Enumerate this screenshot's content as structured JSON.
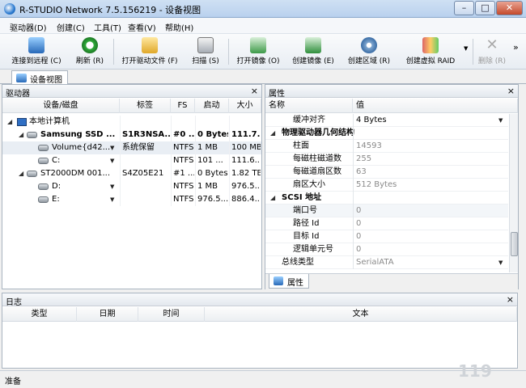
{
  "window": {
    "title": "R-STUDIO Network 7.5.156219 - 设备视图"
  },
  "menu": [
    "驱动器(D)",
    "创建(C)",
    "工具(T)",
    "查看(V)",
    "帮助(H)"
  ],
  "toolbar": [
    {
      "label": "连接到远程 (C)",
      "icon": "connect-remote-icon"
    },
    {
      "label": "刷新 (R)",
      "icon": "refresh-icon"
    },
    {
      "label": "打开驱动文件 (F)",
      "icon": "open-drive-file-icon"
    },
    {
      "label": "扫描 (S)",
      "icon": "scan-icon"
    },
    {
      "label": "打开镜像 (O)",
      "icon": "open-image-icon"
    },
    {
      "label": "创建镜像 (E)",
      "icon": "create-image-icon"
    },
    {
      "label": "创建区域 (R)",
      "icon": "create-region-icon"
    },
    {
      "label": "创建虚拟 RAID",
      "icon": "create-virtual-raid-icon"
    },
    {
      "label": "删除 (R)",
      "icon": "delete-icon"
    }
  ],
  "toolbar_more": "»",
  "tab": {
    "label": "设备视图"
  },
  "drives_panel": {
    "title": "驱动器",
    "close": "×",
    "columns": [
      "设备/磁盘",
      "标签",
      "FS",
      "启动",
      "大小"
    ],
    "rows": [
      {
        "indent": 0,
        "kind": "pc",
        "expander": "◢",
        "name": "本地计算机",
        "label": "",
        "fs": "",
        "start": "",
        "size": "",
        "bold": false,
        "dropdown": false
      },
      {
        "indent": 1,
        "kind": "disk",
        "expander": "◢",
        "name": "Samsung SSD ...",
        "label": "S1R3NSA...",
        "fs": "#0 ...",
        "start": "0 Bytes",
        "size": "111.7...",
        "bold": true,
        "dropdown": false
      },
      {
        "indent": 2,
        "kind": "volume",
        "expander": "",
        "name": "Volume{d42...",
        "label": "系统保留",
        "fs": "NTFS",
        "start": "1 MB",
        "size": "100 MB",
        "bold": false,
        "dropdown": true,
        "selected": true
      },
      {
        "indent": 2,
        "kind": "volume",
        "expander": "",
        "name": "C:",
        "label": "",
        "fs": "NTFS",
        "start": "101 ...",
        "size": "111.6...",
        "bold": false,
        "dropdown": true
      },
      {
        "indent": 1,
        "kind": "disk",
        "expander": "◢",
        "name": "ST2000DM 001...",
        "label": "S4Z05E21",
        "fs": "#1 ...",
        "start": "0 Bytes",
        "size": "1.82 TB",
        "bold": false,
        "dropdown": false
      },
      {
        "indent": 2,
        "kind": "volume",
        "expander": "",
        "name": "D:",
        "label": "",
        "fs": "NTFS",
        "start": "1 MB",
        "size": "976.5...",
        "bold": false,
        "dropdown": true
      },
      {
        "indent": 2,
        "kind": "volume",
        "expander": "",
        "name": "E:",
        "label": "",
        "fs": "NTFS",
        "start": "976.5...",
        "size": "886.4...",
        "bold": false,
        "dropdown": true
      }
    ]
  },
  "props_panel": {
    "title": "属性",
    "close": "×",
    "columns": [
      "名称",
      "值"
    ],
    "rows": [
      {
        "type": "prop",
        "name": "缓冲对齐",
        "value": "4 Bytes",
        "gray": false,
        "dropdown": true
      },
      {
        "type": "group",
        "name": "物理驱动器几何结构"
      },
      {
        "type": "prop",
        "name": "柱面",
        "value": "14593",
        "gray": true,
        "dropdown": false
      },
      {
        "type": "prop",
        "name": "每磁柱磁道数",
        "value": "255",
        "gray": true,
        "dropdown": false
      },
      {
        "type": "prop",
        "name": "每磁道扇区数",
        "value": "63",
        "gray": true,
        "dropdown": false
      },
      {
        "type": "prop",
        "name": "扇区大小",
        "value": "512 Bytes",
        "gray": true,
        "dropdown": false
      },
      {
        "type": "group",
        "name": "SCSI 地址"
      },
      {
        "type": "prop",
        "name": "端口号",
        "value": "0",
        "gray": true,
        "dropdown": false,
        "highlight": true
      },
      {
        "type": "prop",
        "name": "路径 Id",
        "value": "0",
        "gray": true,
        "dropdown": false
      },
      {
        "type": "prop",
        "name": "目标 Id",
        "value": "0",
        "gray": true,
        "dropdown": false
      },
      {
        "type": "prop",
        "name": "逻辑单元号",
        "value": "0",
        "gray": true,
        "dropdown": false
      },
      {
        "type": "prop",
        "name": "总线类型",
        "value": "SerialATA",
        "gray": true,
        "dropdown": true,
        "outdent": true
      }
    ],
    "bottom_tab": "属性"
  },
  "log_panel": {
    "title": "日志",
    "close": "×",
    "columns": [
      "类型",
      "日期",
      "时间",
      "文本"
    ]
  },
  "status": {
    "text": "准备"
  }
}
